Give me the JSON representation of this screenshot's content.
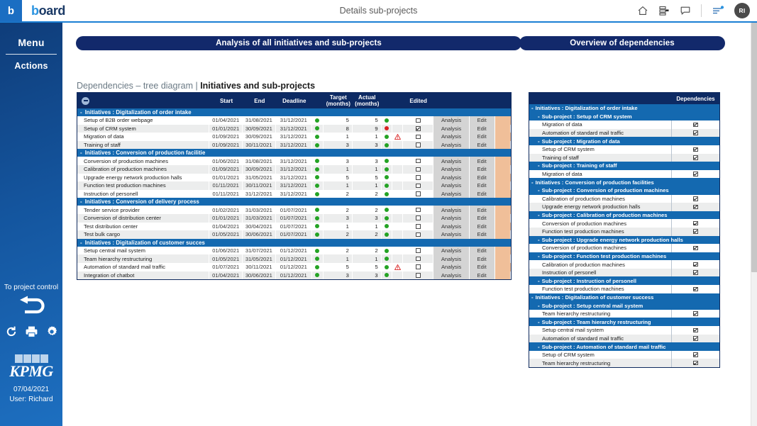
{
  "topbar": {
    "logo_letter": "b",
    "brand": "board",
    "title": "Details sub-projects",
    "icons": [
      "home-icon",
      "layout-icon",
      "chat-icon",
      "list-settings-icon"
    ],
    "avatar_initials": "RI"
  },
  "sidebar": {
    "menu_label": "Menu",
    "actions_label": "Actions",
    "to_project_control": "To project control",
    "tools": [
      "refresh-icon",
      "print-icon",
      "gear-icon"
    ],
    "brand_logo": "KPMG",
    "date": "07/04/2021",
    "user": "User: Richard"
  },
  "banners": {
    "left": "Analysis of all initiatives and sub-projects",
    "right": "Overview of dependencies"
  },
  "subtitle": {
    "prefix": "Dependencies – tree diagram | ",
    "bold": "Initiatives and sub-projects"
  },
  "left_table": {
    "columns": [
      "",
      "Start",
      "End",
      "Deadline",
      "",
      "Target (months)",
      "Actual (months)",
      "",
      "",
      "Edited",
      "",
      ""
    ],
    "header": {
      "start": "Start",
      "end": "End",
      "deadline": "Deadline",
      "target_l1": "Target",
      "target_l2": "(months)",
      "actual_l1": "Actual",
      "actual_l2": "(months)",
      "edited": "Edited"
    },
    "action_label": "Analysis",
    "edit_label": "Edit",
    "groups": [
      {
        "title": "Initiatives : Digitalization of order intake",
        "rows": [
          {
            "name": "Setup of B2B order webpage",
            "start": "01/04/2021",
            "end": "31/08/2021",
            "deadline": "31/12/2021",
            "dot1": "green",
            "target": "5",
            "actual": "5",
            "dot2": "green",
            "warn": false,
            "checked": false
          },
          {
            "name": "Setup of CRM system",
            "start": "01/01/2021",
            "end": "30/09/2021",
            "deadline": "31/12/2021",
            "dot1": "green",
            "target": "8",
            "actual": "9",
            "dot2": "red",
            "warn": false,
            "checked": true
          },
          {
            "name": "Migration of data",
            "start": "01/09/2021",
            "end": "30/09/2021",
            "deadline": "31/12/2021",
            "dot1": "green",
            "target": "1",
            "actual": "1",
            "dot2": "green",
            "warn": true,
            "checked": false
          },
          {
            "name": "Training of staff",
            "start": "01/09/2021",
            "end": "30/11/2021",
            "deadline": "31/12/2021",
            "dot1": "green",
            "target": "3",
            "actual": "3",
            "dot2": "green",
            "warn": false,
            "checked": false
          }
        ]
      },
      {
        "title": "Initiatives : Conversion of production facilitie",
        "rows": [
          {
            "name": "Conversion of production machines",
            "start": "01/06/2021",
            "end": "31/08/2021",
            "deadline": "31/12/2021",
            "dot1": "green",
            "target": "3",
            "actual": "3",
            "dot2": "green",
            "warn": false,
            "checked": false
          },
          {
            "name": "Calibration of production machines",
            "start": "01/09/2021",
            "end": "30/09/2021",
            "deadline": "31/12/2021",
            "dot1": "green",
            "target": "1",
            "actual": "1",
            "dot2": "green",
            "warn": false,
            "checked": false
          },
          {
            "name": "Upgrade energy network production halls",
            "start": "01/01/2021",
            "end": "31/05/2021",
            "deadline": "31/12/2021",
            "dot1": "green",
            "target": "5",
            "actual": "5",
            "dot2": "green",
            "warn": false,
            "checked": false
          },
          {
            "name": "Function test production machines",
            "start": "01/11/2021",
            "end": "30/11/2021",
            "deadline": "31/12/2021",
            "dot1": "green",
            "target": "1",
            "actual": "1",
            "dot2": "green",
            "warn": false,
            "checked": false
          },
          {
            "name": "Instruction of personell",
            "start": "01/11/2021",
            "end": "31/12/2021",
            "deadline": "31/12/2021",
            "dot1": "green",
            "target": "2",
            "actual": "2",
            "dot2": "green",
            "warn": false,
            "checked": false
          }
        ]
      },
      {
        "title": "Initiatives : Conversion of delivery process",
        "rows": [
          {
            "name": "Tender service provider",
            "start": "01/02/2021",
            "end": "31/03/2021",
            "deadline": "01/07/2021",
            "dot1": "green",
            "target": "2",
            "actual": "2",
            "dot2": "green",
            "warn": false,
            "checked": false
          },
          {
            "name": "Conversion of distribution center",
            "start": "01/01/2021",
            "end": "31/03/2021",
            "deadline": "01/07/2021",
            "dot1": "green",
            "target": "3",
            "actual": "3",
            "dot2": "green",
            "warn": false,
            "checked": false
          },
          {
            "name": "Test distribution center",
            "start": "01/04/2021",
            "end": "30/04/2021",
            "deadline": "01/07/2021",
            "dot1": "green",
            "target": "1",
            "actual": "1",
            "dot2": "green",
            "warn": false,
            "checked": false
          },
          {
            "name": "Test bulk cargo",
            "start": "01/05/2021",
            "end": "30/06/2021",
            "deadline": "01/07/2021",
            "dot1": "green",
            "target": "2",
            "actual": "2",
            "dot2": "green",
            "warn": false,
            "checked": false
          }
        ]
      },
      {
        "title": "Initiatives : Digitalization of customer succes",
        "rows": [
          {
            "name": "Setup central mail system",
            "start": "01/06/2021",
            "end": "31/07/2021",
            "deadline": "01/12/2021",
            "dot1": "green",
            "target": "2",
            "actual": "2",
            "dot2": "green",
            "warn": false,
            "checked": false
          },
          {
            "name": "Team hierarchy restructuring",
            "start": "01/05/2021",
            "end": "31/05/2021",
            "deadline": "01/12/2021",
            "dot1": "green",
            "target": "1",
            "actual": "1",
            "dot2": "green",
            "warn": false,
            "checked": false
          },
          {
            "name": "Automation of standard mail traffic",
            "start": "01/07/2021",
            "end": "30/11/2021",
            "deadline": "01/12/2021",
            "dot1": "green",
            "target": "5",
            "actual": "5",
            "dot2": "green",
            "warn": true,
            "checked": false
          },
          {
            "name": "Integration of chatbot",
            "start": "01/04/2021",
            "end": "30/06/2021",
            "deadline": "01/12/2021",
            "dot1": "green",
            "target": "3",
            "actual": "3",
            "dot2": "green",
            "warn": false,
            "checked": false
          }
        ]
      }
    ]
  },
  "right_table": {
    "header": {
      "name": "",
      "dependencies": "Dependencies"
    },
    "entries": [
      {
        "kind": "initiative",
        "label": "Initiatives : Digitalization of order intake"
      },
      {
        "kind": "subproject",
        "label": "Sub-project : Setup of CRM system"
      },
      {
        "kind": "item",
        "label": "Migration of data",
        "checked": true
      },
      {
        "kind": "item",
        "label": "Automation of standard mail traffic",
        "checked": true
      },
      {
        "kind": "subproject",
        "label": "Sub-project : Migration of data"
      },
      {
        "kind": "item",
        "label": "Setup of CRM system",
        "checked": true
      },
      {
        "kind": "item",
        "label": "Training of staff",
        "checked": true
      },
      {
        "kind": "subproject",
        "label": "Sub-project : Training of staff"
      },
      {
        "kind": "item",
        "label": "Migration of data",
        "checked": true
      },
      {
        "kind": "initiative",
        "label": "Initiatives : Conversion of production facilities"
      },
      {
        "kind": "subproject",
        "label": "Sub-project : Conversion of production machines"
      },
      {
        "kind": "item",
        "label": "Calibration of production machines",
        "checked": true
      },
      {
        "kind": "item",
        "label": "Upgrade energy network production halls",
        "checked": true
      },
      {
        "kind": "subproject",
        "label": "Sub-project : Calibration of production machines"
      },
      {
        "kind": "item",
        "label": "Conversion of production machines",
        "checked": true
      },
      {
        "kind": "item",
        "label": "Function test production machines",
        "checked": true
      },
      {
        "kind": "subproject",
        "label": "Sub-project : Upgrade energy network production halls"
      },
      {
        "kind": "item",
        "label": "Conversion of production machines",
        "checked": true
      },
      {
        "kind": "subproject",
        "label": "Sub-project : Function test production machines"
      },
      {
        "kind": "item",
        "label": "Calibration of production machines",
        "checked": true
      },
      {
        "kind": "item",
        "label": "Instruction of personell",
        "checked": true
      },
      {
        "kind": "subproject",
        "label": "Sub-project : Instruction of personell"
      },
      {
        "kind": "item",
        "label": "Function test production machines",
        "checked": true
      },
      {
        "kind": "initiative",
        "label": "Initiatives : Digitalization of customer success"
      },
      {
        "kind": "subproject",
        "label": "Sub-project : Setup central mail system"
      },
      {
        "kind": "item",
        "label": "Team hierarchy restructuring",
        "checked": true
      },
      {
        "kind": "subproject",
        "label": "Sub-project : Team hierarchy restructuring"
      },
      {
        "kind": "item",
        "label": "Setup central mail system",
        "checked": true
      },
      {
        "kind": "item",
        "label": "Automation of standard mail traffic",
        "checked": true
      },
      {
        "kind": "subproject",
        "label": "Sub-project : Automation of standard mail traffic"
      },
      {
        "kind": "item",
        "label": "Setup of CRM system",
        "checked": true
      },
      {
        "kind": "item",
        "label": "Team hierarchy restructuring",
        "checked": true
      }
    ]
  },
  "colors": {
    "brand_dark": "#0d2a63",
    "group_blue": "#1469b0",
    "banner": "#12296b",
    "strip": "#f0bf99",
    "status_green": "#24a324",
    "status_red": "#d92222",
    "warning": "#d92222"
  }
}
